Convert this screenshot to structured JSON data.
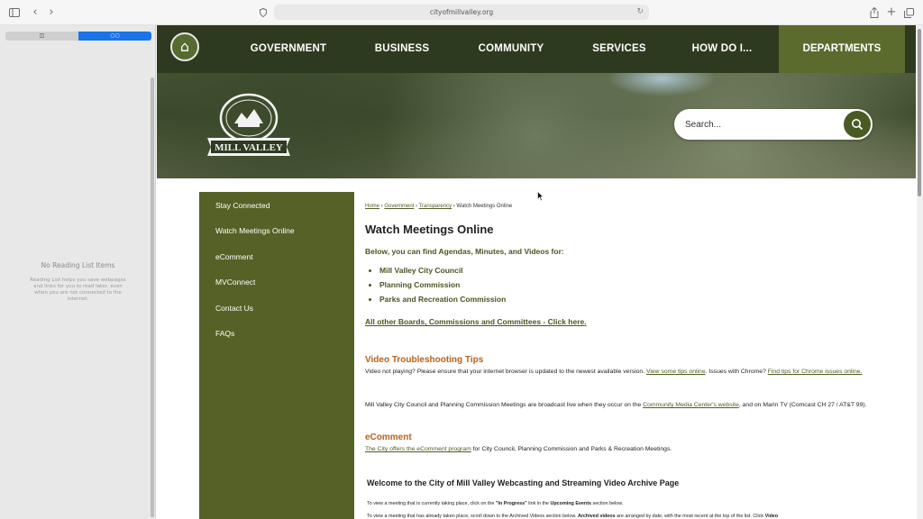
{
  "browser": {
    "url": "cityofmillvalley.org",
    "sidebar_toggle_icon": "sidebar-icon",
    "back_icon": "chevron-left-icon",
    "forward_icon": "chevron-right-icon",
    "share_icon": "share-icon",
    "new_tab_icon": "plus-icon",
    "tabs_icon": "tabs-icon"
  },
  "reading_list": {
    "segment_left": "◫",
    "segment_right": "○○",
    "title": "No Reading List Items",
    "description": "Reading List helps you save webpages and links for you to read later, even when you are not connected to the internet."
  },
  "nav": {
    "items": [
      "GOVERNMENT",
      "BUSINESS",
      "COMMUNITY",
      "SERVICES",
      "HOW DO I..."
    ],
    "departments": "DEPARTMENTS"
  },
  "hero": {
    "logo_text": "MILL VALLEY",
    "search_placeholder": "Search..."
  },
  "subnav": {
    "items": [
      "Stay Connected",
      "Watch Meetings Online",
      "eComment",
      "MVConnect",
      "Contact Us",
      "FAQs"
    ]
  },
  "content": {
    "breadcrumb": {
      "home": "Home",
      "government": "Government",
      "transparency": "Transparency",
      "current": "Watch Meetings Online",
      "separator": "›"
    },
    "title": "Watch Meetings Online",
    "lead": "Below, you can find Agendas, Minutes, and Videos for:",
    "bullets": [
      "Mill Valley City Council",
      "Planning Commission",
      "Parks and Recreation Commission"
    ],
    "all_boards": "All other Boards, Commissions and Committees - Click here",
    "video_tips_heading": "Video Troubleshooting Tips",
    "video_tips": {
      "t1": "Video not playing? Please ensure that your internet browser is updated to the newest available version.",
      "l1": "View some tips online",
      "t2": ". Issues with Chrome?",
      "l2": "Find tips for Chrome issues online."
    },
    "broadcast": {
      "t1": "Mill Valley City Council and Planning Commission Meetings are broadcast live when they occur on the",
      "l1": "Community Media Center's website",
      "t2": ", and on Marin TV (Comcast CH 27 / AT&T 99)."
    },
    "ecomment_heading": "eComment",
    "ecomment": {
      "l1": "The City offers the eComment program",
      "t1": "for City Council, Planning Commission and Parks & Recreation Meetings."
    },
    "welcome_heading": "Welcome to the City of Mill Valley Webcasting and Streaming Video Archive Page",
    "instruction1": {
      "t1": "To view a meeting that is currently taking place, click on the",
      "b1": "\"In Progress\"",
      "t2": "link in the",
      "b2": "Upcoming Events",
      "t3": "section below."
    },
    "instruction2": {
      "t1": "To view a meeting that has already taken place, scroll down to the Archived Videos section below.",
      "b1": "Archived videos",
      "t2": "are arranged by date, with the most recent at the top of the list. Click",
      "b2": "Video"
    }
  }
}
